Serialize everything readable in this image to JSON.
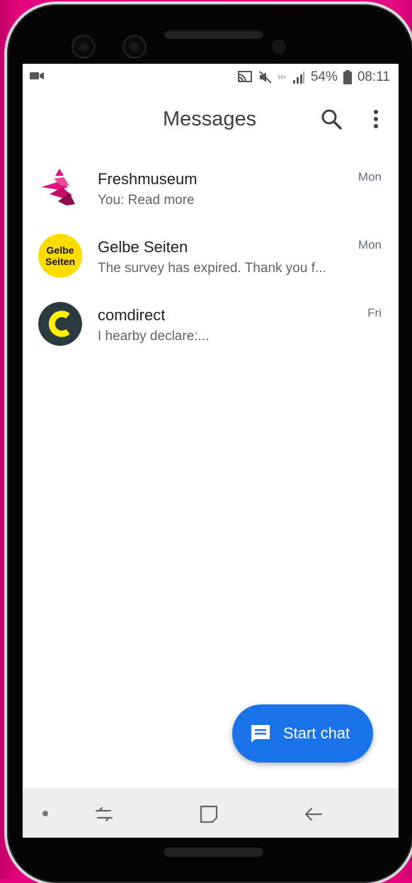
{
  "status_bar": {
    "battery_percent": "54%",
    "time": "08:11",
    "network_label": "H+"
  },
  "app_bar": {
    "title": "Messages",
    "search_icon": "search-icon",
    "more_icon": "more-vert-icon"
  },
  "conversations": [
    {
      "name": "Freshmuseum",
      "snippet": "You: Read more",
      "date": "Mon",
      "avatar": "freshmuseum-logo"
    },
    {
      "name": "Gelbe Seiten",
      "snippet": "The survey has expired. Thank you f...",
      "date": "Mon",
      "avatar": "gelbe-seiten-logo",
      "avatar_text_1": "Gelbe",
      "avatar_text_2": "Seiten"
    },
    {
      "name": "comdirect",
      "snippet": "I hearby declare:...",
      "date": "Fri",
      "avatar": "comdirect-logo"
    }
  ],
  "fab": {
    "label": "Start chat",
    "icon": "chat-icon"
  },
  "colors": {
    "accent": "#1a73e8",
    "background_frame": "#e6007e",
    "gelbe_yellow": "#ffdc00",
    "comdirect_yellow": "#fff200",
    "comdirect_dark": "#2b3a3e"
  }
}
